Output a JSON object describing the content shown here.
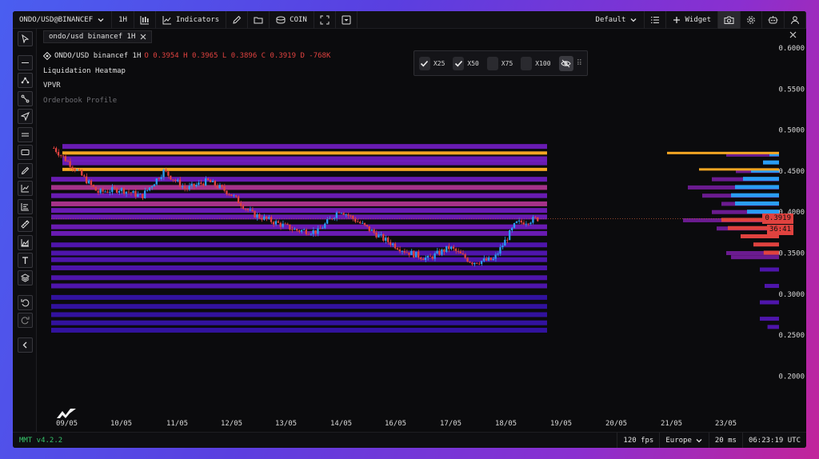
{
  "topbar": {
    "symbol": "ONDO/USD@BINANCEF",
    "interval": "1H",
    "indicators_label": "Indicators",
    "coin_label": "COIN",
    "layout": "Default",
    "widget_label": "Widget"
  },
  "tab": {
    "label": "ondo/usd binancef 1H"
  },
  "legend": {
    "symbol": "ONDO/USD binancef 1H",
    "ohlc": "O 0.3954 H 0.3965 L 0.3896 C 0.3919 D -768K",
    "indicators": [
      "Liquidation Heatmap",
      "VPVR",
      "Orderbook Profile"
    ]
  },
  "multipliers": [
    {
      "label": "X25",
      "checked": true
    },
    {
      "label": "X50",
      "checked": true
    },
    {
      "label": "X75",
      "checked": false
    },
    {
      "label": "X100",
      "checked": false
    }
  ],
  "price_axis": {
    "ticks": [
      "0.6000",
      "0.5500",
      "0.5000",
      "0.4500",
      "0.4000",
      "0.3500",
      "0.3000",
      "0.2500",
      "0.2000"
    ],
    "last_price": "0.3919",
    "countdown": "36:41"
  },
  "time_axis": {
    "ticks": [
      "09/05",
      "10/05",
      "11/05",
      "12/05",
      "13/05",
      "14/05",
      "16/05",
      "17/05",
      "18/05",
      "19/05",
      "20/05",
      "21/05",
      "23/05"
    ]
  },
  "bottombar": {
    "version": "MMT v4.2.2",
    "fps": "120 fps",
    "region": "Europe",
    "latency": "20 ms",
    "clock": "06:23:19 UTC"
  },
  "colors": {
    "bull": "#2a9df4",
    "bear": "#e0423f",
    "heat_low": "#3a14b8",
    "heat_mid": "#7a1fd0",
    "heat_high": "#f5a623",
    "background": "#0b0b0d"
  },
  "chart_data": {
    "type": "candlestick",
    "instrument": "ONDO/USD binancef 1H",
    "price_range": [
      0.18,
      0.61
    ],
    "close_path": [
      [
        "09/05",
        0.478
      ],
      [
        "09/05",
        0.452
      ],
      [
        "10/05",
        0.424
      ],
      [
        "10/05",
        0.428
      ],
      [
        "11/05",
        0.419
      ],
      [
        "11/05",
        0.45
      ],
      [
        "11/05",
        0.428
      ],
      [
        "12/05",
        0.438
      ],
      [
        "12/05",
        0.423
      ],
      [
        "12/05",
        0.398
      ],
      [
        "13/05",
        0.388
      ],
      [
        "13/05",
        0.378
      ],
      [
        "14/05",
        0.376
      ],
      [
        "14/05",
        0.403
      ],
      [
        "14/05",
        0.385
      ],
      [
        "16/05",
        0.367
      ],
      [
        "16/05",
        0.352
      ],
      [
        "17/05",
        0.343
      ],
      [
        "17/05",
        0.357
      ],
      [
        "18/05",
        0.339
      ],
      [
        "18/05",
        0.342
      ],
      [
        "18/05",
        0.386
      ],
      [
        "19/05",
        0.392
      ]
    ],
    "heatmap_levels": [
      {
        "price": 0.472,
        "intensity": 1.0
      },
      {
        "price": 0.452,
        "intensity": 0.95
      },
      {
        "price": 0.48,
        "intensity": 0.55
      },
      {
        "price": 0.465,
        "intensity": 0.5
      },
      {
        "price": 0.46,
        "intensity": 0.45
      },
      {
        "price": 0.44,
        "intensity": 0.5
      },
      {
        "price": 0.43,
        "intensity": 0.6
      },
      {
        "price": 0.42,
        "intensity": 0.5
      },
      {
        "price": 0.41,
        "intensity": 0.65
      },
      {
        "price": 0.402,
        "intensity": 0.55
      },
      {
        "price": 0.394,
        "intensity": 0.5
      },
      {
        "price": 0.382,
        "intensity": 0.45
      },
      {
        "price": 0.374,
        "intensity": 0.5
      },
      {
        "price": 0.36,
        "intensity": 0.4
      },
      {
        "price": 0.35,
        "intensity": 0.35
      },
      {
        "price": 0.342,
        "intensity": 0.35
      },
      {
        "price": 0.332,
        "intensity": 0.3
      },
      {
        "price": 0.32,
        "intensity": 0.3
      },
      {
        "price": 0.31,
        "intensity": 0.3
      },
      {
        "price": 0.296,
        "intensity": 0.25
      },
      {
        "price": 0.285,
        "intensity": 0.25
      },
      {
        "price": 0.275,
        "intensity": 0.2
      },
      {
        "price": 0.265,
        "intensity": 0.2
      },
      {
        "price": 0.256,
        "intensity": 0.2
      }
    ],
    "orderbook_profile": [
      {
        "price": 0.47,
        "bid": 0,
        "ask": 0.12
      },
      {
        "price": 0.46,
        "bid": 0,
        "ask": 0.2
      },
      {
        "price": 0.45,
        "bid": 0,
        "ask": 0.35
      },
      {
        "price": 0.44,
        "bid": 0,
        "ask": 0.45
      },
      {
        "price": 0.43,
        "bid": 0,
        "ask": 0.55
      },
      {
        "price": 0.42,
        "bid": 0,
        "ask": 0.6
      },
      {
        "price": 0.41,
        "bid": 0,
        "ask": 0.55
      },
      {
        "price": 0.4,
        "bid": 0,
        "ask": 0.4
      },
      {
        "price": 0.39,
        "bid": 0.45,
        "ask": 0
      },
      {
        "price": 0.38,
        "bid": 0.4,
        "ask": 0
      },
      {
        "price": 0.37,
        "bid": 0.3,
        "ask": 0
      },
      {
        "price": 0.36,
        "bid": 0.2,
        "ask": 0
      },
      {
        "price": 0.35,
        "bid": 0.12,
        "ask": 0
      }
    ],
    "vpvr": [
      {
        "price": 0.47,
        "volume": 0.55
      },
      {
        "price": 0.45,
        "volume": 0.45
      },
      {
        "price": 0.44,
        "volume": 0.7
      },
      {
        "price": 0.43,
        "volume": 0.95
      },
      {
        "price": 0.42,
        "volume": 0.8
      },
      {
        "price": 0.41,
        "volume": 0.6
      },
      {
        "price": 0.4,
        "volume": 0.7
      },
      {
        "price": 0.39,
        "volume": 1.0
      },
      {
        "price": 0.38,
        "volume": 0.65
      },
      {
        "price": 0.35,
        "volume": 0.55
      },
      {
        "price": 0.345,
        "volume": 0.5
      },
      {
        "price": 0.33,
        "volume": 0.2
      },
      {
        "price": 0.31,
        "volume": 0.15
      },
      {
        "price": 0.29,
        "volume": 0.2
      },
      {
        "price": 0.27,
        "volume": 0.2
      },
      {
        "price": 0.26,
        "volume": 0.12
      }
    ]
  }
}
